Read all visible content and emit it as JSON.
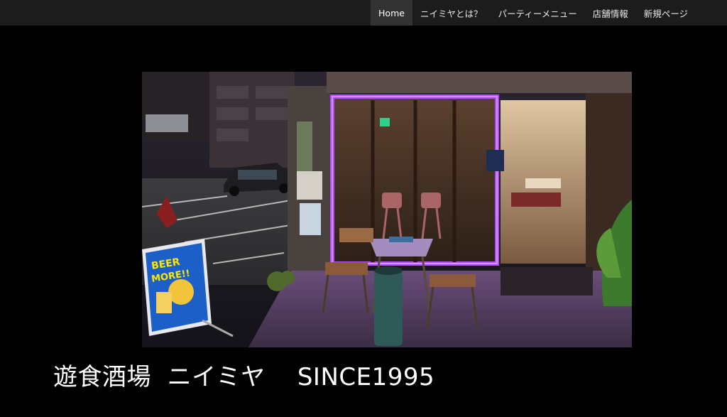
{
  "nav": {
    "items": [
      {
        "label": "Home",
        "active": true
      },
      {
        "label": "ニイミヤとは？",
        "active": false
      },
      {
        "label": "パーティーメニュー",
        "active": false
      },
      {
        "label": "店舗情報",
        "active": false
      },
      {
        "label": "新規ページ",
        "active": false
      }
    ]
  },
  "hero": {
    "sign_text_1": "BEER",
    "sign_text_2": "MORE!!"
  },
  "page": {
    "title": "遊食酒場  ニイミヤ    SINCE1995"
  },
  "colors": {
    "neon": "#b14cff",
    "topbar": "#1c1c1c",
    "active_bg": "#333333"
  }
}
